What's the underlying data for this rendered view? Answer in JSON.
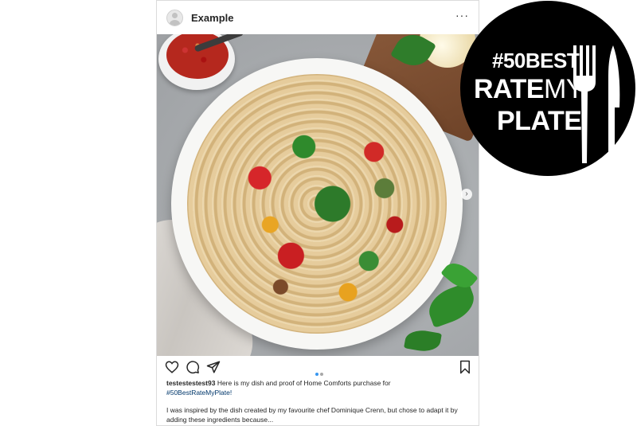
{
  "post": {
    "username": "Example",
    "more_label": "···",
    "carousel_arrow": "›",
    "caption": {
      "user": "testestestest93",
      "text": "Here is my dish and proof of Home Comforts purchase for",
      "hashtag": "#50BestRateMyPlate!",
      "body": "I was inspired by the dish created by my favourite chef Dominique Crenn, but chose to adapt it by adding these ingredients because..."
    },
    "actions": {
      "like_icon": "heart-icon",
      "comment_icon": "comment-icon",
      "share_icon": "send-icon",
      "save_icon": "bookmark-icon"
    },
    "carousel_dots": {
      "count": 2,
      "active": 0,
      "active_color": "#3897f0",
      "inactive_color": "#a8a8a8"
    }
  },
  "badge": {
    "line1": "#50BEST",
    "line2_bold": "RATE",
    "line2_light": "MY",
    "line3": "PLATE",
    "icon": "fork-knife-icon",
    "background": "#000000",
    "text_color": "#ffffff"
  }
}
